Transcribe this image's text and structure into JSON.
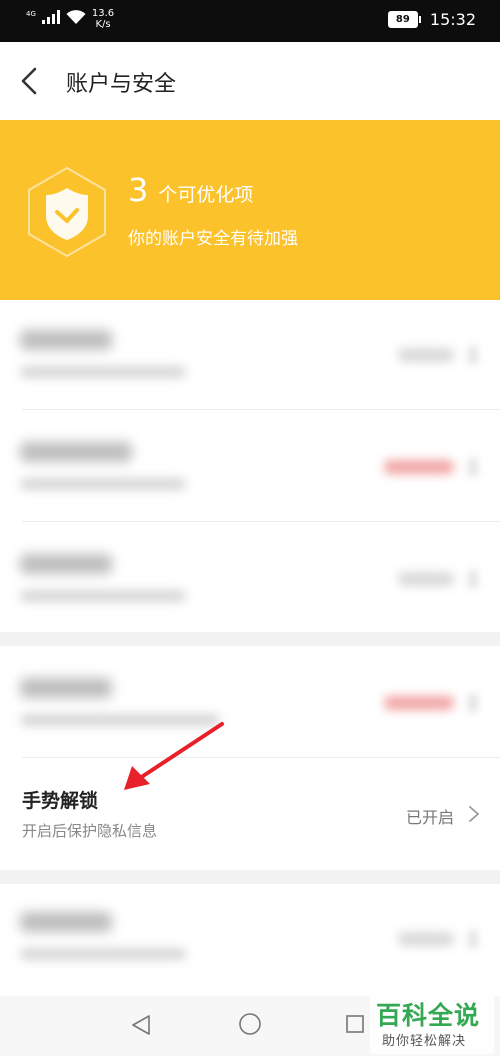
{
  "status_bar": {
    "network": "4G",
    "speed_value": "13.6",
    "speed_unit": "K/s",
    "battery": "89",
    "time": "15:32"
  },
  "header": {
    "title": "账户与安全",
    "back_icon": "chevron-left-icon"
  },
  "banner": {
    "count": "3",
    "count_label": "个可优化项",
    "subtitle": "你的账户安全有待加强",
    "background": "#fcc22c",
    "icon": "shield-check-icon"
  },
  "gesture_unlock": {
    "title": "手势解锁",
    "description": "开启后保护隐私信息",
    "status": "已开启"
  },
  "watermark": {
    "main": "百科全说",
    "sub": "助你轻松解决",
    "color": "#34a853"
  },
  "colors": {
    "annotation_arrow": "#e8202a",
    "banner": "#fcc22c"
  }
}
